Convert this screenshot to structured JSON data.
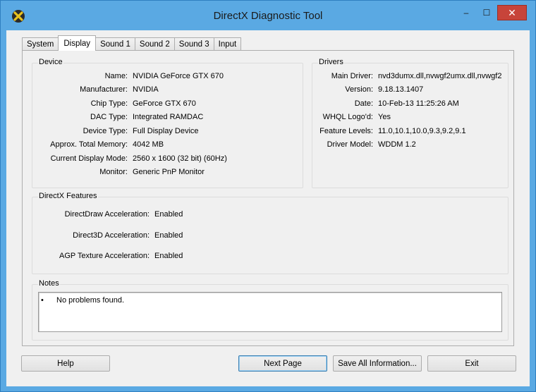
{
  "window": {
    "title": "DirectX Diagnostic Tool",
    "controls": {
      "minimize": "–",
      "maximize": "☐",
      "close": "✕"
    }
  },
  "tabs": [
    {
      "label": "System",
      "active": false
    },
    {
      "label": "Display",
      "active": true
    },
    {
      "label": "Sound 1",
      "active": false
    },
    {
      "label": "Sound 2",
      "active": false
    },
    {
      "label": "Sound 3",
      "active": false
    },
    {
      "label": "Input",
      "active": false
    }
  ],
  "device": {
    "title": "Device",
    "rows": [
      {
        "label": "Name:",
        "value": "NVIDIA GeForce GTX 670"
      },
      {
        "label": "Manufacturer:",
        "value": "NVIDIA"
      },
      {
        "label": "Chip Type:",
        "value": "GeForce GTX 670"
      },
      {
        "label": "DAC Type:",
        "value": "Integrated RAMDAC"
      },
      {
        "label": "Device Type:",
        "value": "Full Display Device"
      },
      {
        "label": "Approx. Total Memory:",
        "value": "4042 MB"
      },
      {
        "label": "Current Display Mode:",
        "value": "2560 x 1600 (32 bit) (60Hz)"
      },
      {
        "label": "Monitor:",
        "value": "Generic PnP Monitor"
      }
    ]
  },
  "drivers": {
    "title": "Drivers",
    "rows": [
      {
        "label": "Main Driver:",
        "value": "nvd3dumx.dll,nvwgf2umx.dll,nvwgf2"
      },
      {
        "label": "Version:",
        "value": "9.18.13.1407"
      },
      {
        "label": "Date:",
        "value": "10-Feb-13 11:25:26 AM"
      },
      {
        "label": "WHQL Logo'd:",
        "value": "Yes"
      },
      {
        "label": "Feature Levels:",
        "value": "11.0,10.1,10.0,9.3,9.2,9.1"
      },
      {
        "label": "Driver Model:",
        "value": "WDDM 1.2"
      }
    ]
  },
  "features": {
    "title": "DirectX Features",
    "rows": [
      {
        "label": "DirectDraw Acceleration:",
        "value": "Enabled"
      },
      {
        "label": "Direct3D Acceleration:",
        "value": "Enabled"
      },
      {
        "label": "AGP Texture Acceleration:",
        "value": "Enabled"
      }
    ]
  },
  "notes": {
    "title": "Notes",
    "bullet": "•",
    "items": [
      "No problems found."
    ]
  },
  "buttons": {
    "help": "Help",
    "next_page": "Next Page",
    "save_all": "Save All Information...",
    "exit": "Exit"
  }
}
